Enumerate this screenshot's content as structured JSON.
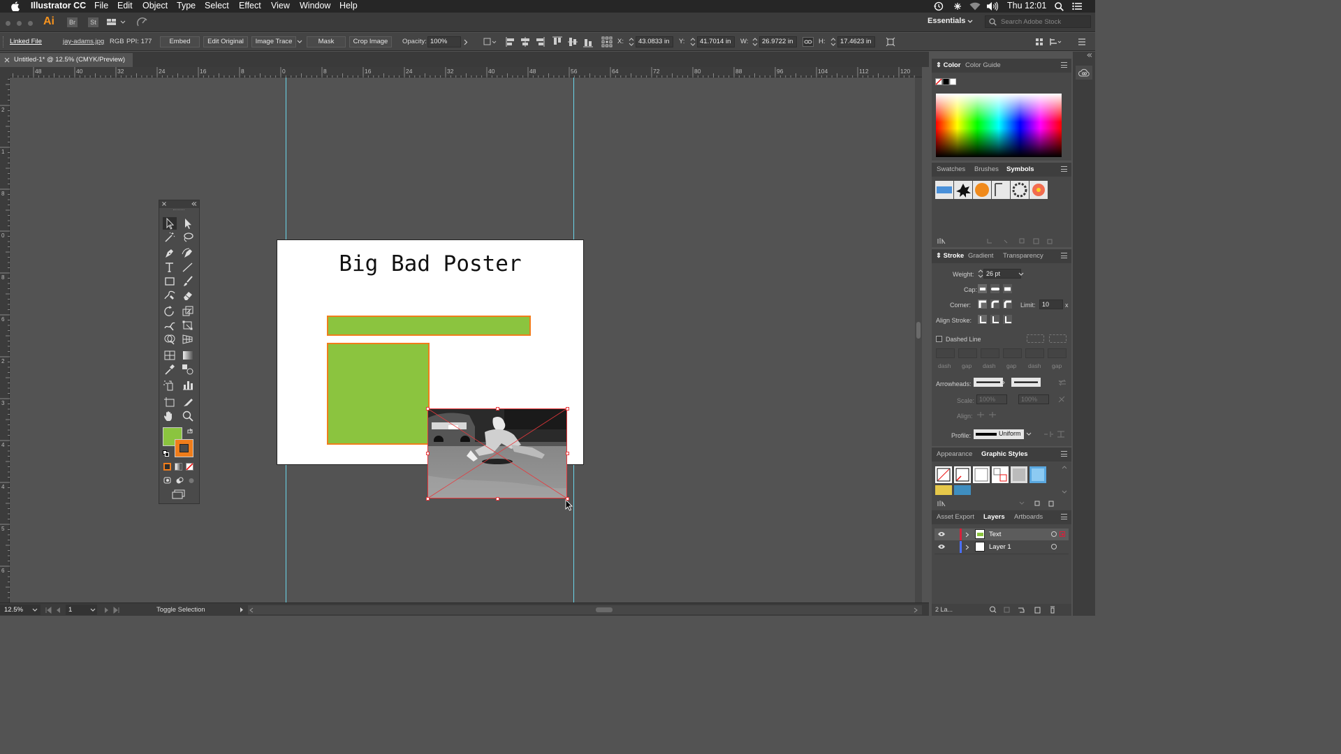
{
  "menubar": {
    "app_name": "Illustrator CC",
    "items": [
      "File",
      "Edit",
      "Object",
      "Type",
      "Select",
      "Effect",
      "View",
      "Window",
      "Help"
    ],
    "clock": "Thu 12:01"
  },
  "appbar": {
    "logo": "Ai",
    "bridge": "Br",
    "stock": "St",
    "workspace": "Essentials",
    "search_placeholder": "Search Adobe Stock"
  },
  "control": {
    "linked_file": "Linked File",
    "filename": "jay-adams.jpg",
    "color_mode": "RGB",
    "ppi": "PPI: 177",
    "embed": "Embed",
    "edit_original": "Edit Original",
    "image_trace": "Image Trace",
    "mask": "Mask",
    "crop_image": "Crop Image",
    "opacity_label": "Opacity:",
    "opacity_value": "100%",
    "x_label": "X:",
    "x_value": "43.0833 in",
    "y_label": "Y:",
    "y_value": "41.7014 in",
    "w_label": "W:",
    "w_value": "26.9722 in",
    "h_label": "H:",
    "h_value": "17.4623 in"
  },
  "document": {
    "tab_title": "Untitled-1* @ 12.5% (CMYK/Preview)"
  },
  "ruler": {
    "h_labels": [
      "48",
      "40",
      "32",
      "24",
      "16",
      "8",
      "0",
      "8",
      "16",
      "24",
      "32",
      "40",
      "48",
      "56",
      "64",
      "72",
      "80",
      "88",
      "96",
      "104",
      "112",
      "120"
    ],
    "v_labels": [
      "2",
      "1",
      "8",
      "0",
      "8",
      "6",
      "2",
      "3",
      "4",
      "4",
      "5",
      "6"
    ]
  },
  "artboard": {
    "title": "Big Bad Poster",
    "fill_color": "#8bc43f",
    "stroke_color": "#f07d1b"
  },
  "status": {
    "zoom": "12.5%",
    "artboard_num": "1",
    "selection_tool": "Toggle Selection"
  },
  "color_panel": {
    "tabs": [
      "Color",
      "Color Guide"
    ]
  },
  "symbols_panel": {
    "tabs": [
      "Swatches",
      "Brushes",
      "Symbols"
    ]
  },
  "stroke_panel": {
    "tabs": [
      "Stroke",
      "Gradient",
      "Transparency"
    ],
    "weight_label": "Weight:",
    "weight_value": "26 pt",
    "cap_label": "Cap:",
    "corner_label": "Corner:",
    "limit_label": "Limit:",
    "limit_value": "10",
    "limit_unit": "x",
    "align_label": "Align Stroke:",
    "dashed_label": "Dashed Line",
    "dash_labels": [
      "dash",
      "gap",
      "dash",
      "gap",
      "dash",
      "gap"
    ],
    "arrowheads_label": "Arrowheads:",
    "scale_label": "Scale:",
    "scale_value": "100%",
    "align_arrow_label": "Align:",
    "profile_label": "Profile:",
    "profile_value": "Uniform"
  },
  "graphic_styles_panel": {
    "tabs": [
      "Appearance",
      "Graphic Styles"
    ]
  },
  "layers_panel": {
    "tabs": [
      "Asset Export",
      "Layers",
      "Artboards"
    ],
    "layers": [
      {
        "name": "Text",
        "color": "#d6213b",
        "selected": true
      },
      {
        "name": "Layer 1",
        "color": "#4a70ff",
        "selected": false
      }
    ],
    "footer": "2 La..."
  }
}
